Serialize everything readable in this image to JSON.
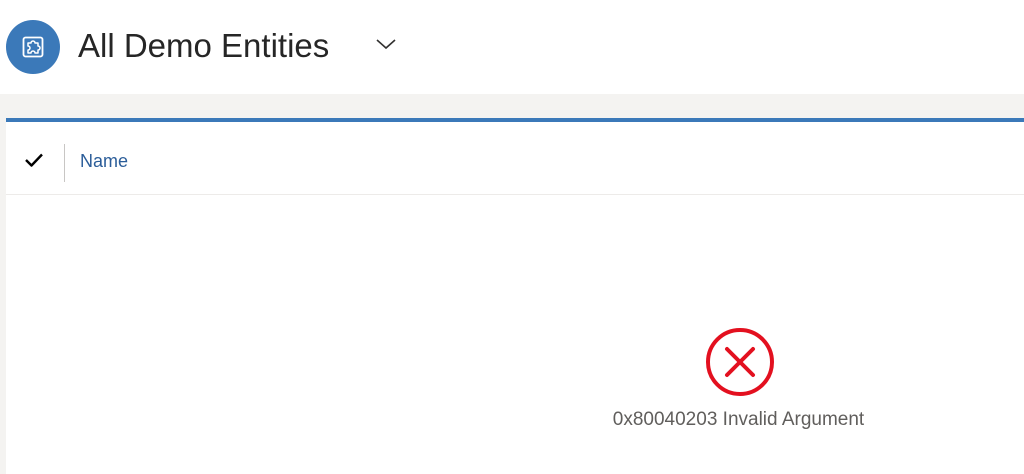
{
  "header": {
    "view_title": "All Demo Entities",
    "entity_icon": "puzzle-piece-icon",
    "selector_icon": "chevron-down-icon"
  },
  "grid": {
    "select_all_icon": "checkmark-icon",
    "columns": [
      {
        "label": "Name"
      }
    ],
    "rows": []
  },
  "error": {
    "icon": "error-circle-x-icon",
    "message": "0x80040203 Invalid Argument"
  },
  "colors": {
    "accent": "#3b79b9",
    "link": "#2b5d99",
    "error": "#e3101f",
    "band": "#f4f3f1",
    "text_muted": "#605e5c"
  }
}
